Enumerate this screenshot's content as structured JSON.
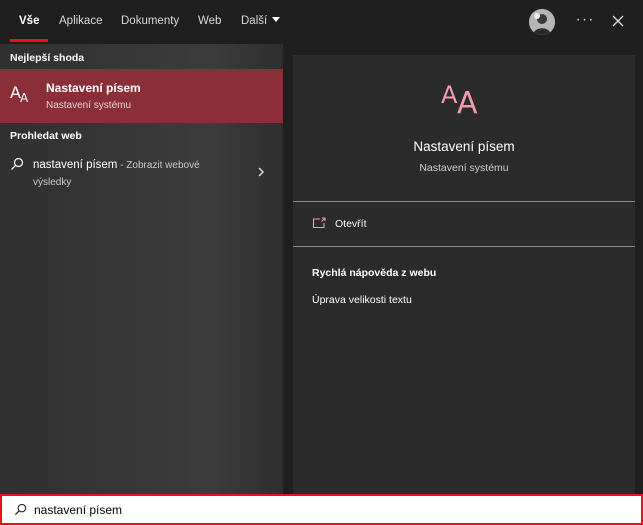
{
  "tabs": [
    {
      "label": "Vše"
    },
    {
      "label": "Aplikace"
    },
    {
      "label": "Dokumenty"
    },
    {
      "label": "Web"
    },
    {
      "label": "Další"
    }
  ],
  "header": {
    "more_label": "···"
  },
  "left": {
    "best_match_heading": "Nejlepší shoda",
    "best_match": {
      "title": "Nastavení písem",
      "subtitle": "Nastavení systému",
      "icon": "font-aa-icon"
    },
    "web_heading": "Prohledat web",
    "web_result": {
      "query": "nastavení písem",
      "hint": " - Zobrazit webové výsledky"
    }
  },
  "detail": {
    "title": "Nastavení písem",
    "subtitle": "Nastavení systému",
    "open_label": "Otevřít",
    "help_heading": "Rychlá nápověda z webu",
    "help_link": "Úprava velikosti textu"
  },
  "search": {
    "value": "nastavení písem"
  },
  "colors": {
    "accent": "#e81123",
    "selected": "#8a2f38",
    "icon_pink": "#f29cac"
  }
}
